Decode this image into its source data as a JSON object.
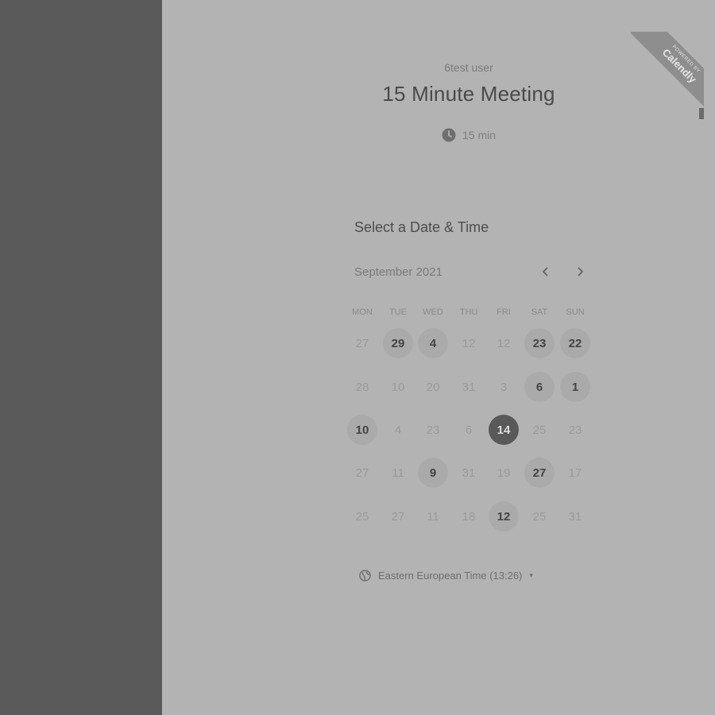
{
  "ribbon": {
    "small": "POWERED BY",
    "brand": "Calendly"
  },
  "header": {
    "host": "6test user",
    "title": "15 Minute Meeting",
    "duration": "15 min"
  },
  "section_title": "Select a Date & Time",
  "calendar": {
    "month": "September 2021",
    "prev_icon": "chevron-left-icon",
    "next_icon": "chevron-right-icon",
    "day_headers": [
      "MON",
      "TUE",
      "WED",
      "THU",
      "FRI",
      "SAT",
      "SUN"
    ],
    "weeks": [
      [
        {
          "d": "27",
          "s": "muted"
        },
        {
          "d": "29",
          "s": "available"
        },
        {
          "d": "4",
          "s": "available"
        },
        {
          "d": "12",
          "s": "muted"
        },
        {
          "d": "12",
          "s": "muted"
        },
        {
          "d": "23",
          "s": "available"
        },
        {
          "d": "22",
          "s": "available"
        }
      ],
      [
        {
          "d": "28",
          "s": "muted"
        },
        {
          "d": "10",
          "s": "muted"
        },
        {
          "d": "20",
          "s": "muted"
        },
        {
          "d": "31",
          "s": "muted"
        },
        {
          "d": "3",
          "s": "muted"
        },
        {
          "d": "6",
          "s": "available"
        },
        {
          "d": "1",
          "s": "available"
        }
      ],
      [
        {
          "d": "10",
          "s": "available"
        },
        {
          "d": "4",
          "s": "muted"
        },
        {
          "d": "23",
          "s": "muted"
        },
        {
          "d": "6",
          "s": "muted"
        },
        {
          "d": "14",
          "s": "selected"
        },
        {
          "d": "25",
          "s": "muted"
        },
        {
          "d": "23",
          "s": "muted"
        }
      ],
      [
        {
          "d": "27",
          "s": "muted"
        },
        {
          "d": "11",
          "s": "muted"
        },
        {
          "d": "9",
          "s": "available"
        },
        {
          "d": "31",
          "s": "muted"
        },
        {
          "d": "19",
          "s": "muted"
        },
        {
          "d": "27",
          "s": "available"
        },
        {
          "d": "17",
          "s": "muted"
        }
      ],
      [
        {
          "d": "25",
          "s": "muted"
        },
        {
          "d": "27",
          "s": "muted"
        },
        {
          "d": "11",
          "s": "muted"
        },
        {
          "d": "18",
          "s": "muted"
        },
        {
          "d": "12",
          "s": "available"
        },
        {
          "d": "25",
          "s": "muted"
        },
        {
          "d": "31",
          "s": "muted"
        }
      ]
    ]
  },
  "timezone": {
    "label": "Eastern European Time (13:26)",
    "caret": "▾"
  },
  "colors": {
    "sidebar": "#5a5a5a",
    "background": "#b3b3b3",
    "selected": "#595959"
  }
}
